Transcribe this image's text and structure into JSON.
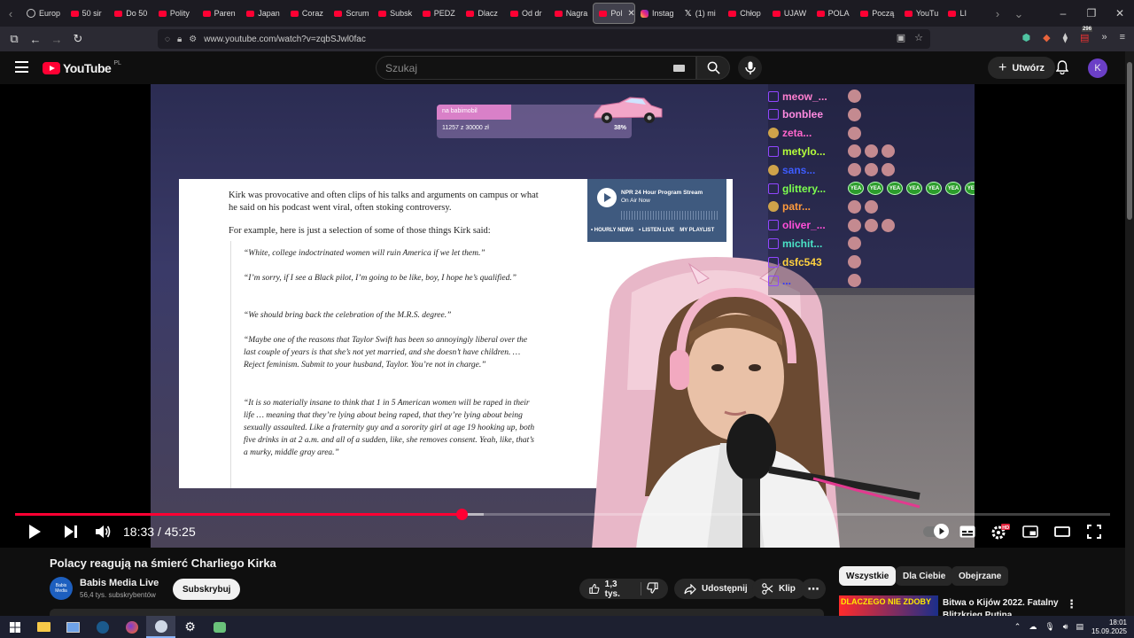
{
  "browser": {
    "tabs": [
      {
        "label": "Europ",
        "icon": "globe"
      },
      {
        "label": "50 sir",
        "icon": "youtube"
      },
      {
        "label": "Do 50",
        "icon": "youtube"
      },
      {
        "label": "Polity",
        "icon": "youtube"
      },
      {
        "label": "Paren",
        "icon": "youtube"
      },
      {
        "label": "Japan",
        "icon": "youtube"
      },
      {
        "label": "Coraz",
        "icon": "youtube"
      },
      {
        "label": "Scrum",
        "icon": "youtube"
      },
      {
        "label": "Subsk",
        "icon": "youtube"
      },
      {
        "label": "PEDZ",
        "icon": "youtube"
      },
      {
        "label": "Dlacz",
        "icon": "youtube"
      },
      {
        "label": "Od dr",
        "icon": "youtube"
      },
      {
        "label": "Nagra",
        "icon": "youtube"
      },
      {
        "label": "Pol",
        "icon": "youtube",
        "active": true
      },
      {
        "label": "Instag",
        "icon": "instagram"
      },
      {
        "label": "(1) mi",
        "icon": "x"
      },
      {
        "label": "Chłop",
        "icon": "youtube"
      },
      {
        "label": "UJAW",
        "icon": "youtube"
      },
      {
        "label": "POLA",
        "icon": "youtube"
      },
      {
        "label": "Począ",
        "icon": "youtube"
      },
      {
        "label": "YouTu",
        "icon": "youtube"
      },
      {
        "label": "LI",
        "icon": "youtube"
      }
    ],
    "url": "www.youtube.com/watch?v=zqbSJwl0fac",
    "extension_badge": "296"
  },
  "youtube": {
    "logo_text": "YouTube",
    "country_code": "PL",
    "search_placeholder": "Szukaj",
    "create_label": "Utwórz",
    "avatar_letter": "K"
  },
  "stream": {
    "donation_goal_name": "na babimobil",
    "donation_amount": "11257 z 30000 zł",
    "donation_percent": "38%",
    "donation_fraction": 0.38,
    "article_p1": "Kirk was provocative and often clips of his talks and arguments on campus or what he said on his podcast went viral, often stoking controversy.",
    "article_p2": "For example, here is just a selection of some of those things Kirk said:",
    "quotes": [
      "“White, college indoctrinated women will ruin America if we let them.”",
      "“I’m sorry, if I see a Black pilot, I’m going to be like, boy, I hope he’s qualified.”",
      "“We should bring back the celebration of the M.R.S. degree.”",
      "“Maybe one of the reasons that Taylor Swift has been so annoyingly liberal over the last couple of years is that she’s not yet married, and she doesn’t have children. … Reject feminism. Submit to your husband, Taylor. You’re not in charge.”",
      "“It is so materially insane to think that 1 in 5 American women will be raped in their life … meaning that they’re lying about being raped, that they’re lying about being sexually assaulted. Like a fraternity guy and a sorority girl at age 19 hooking up, both five drinks in at 2 a.m. and all of a sudden, like, she removes consent. Yeah, like, that’s a murky, middle gray area.”"
    ],
    "npr_title": "NPR 24 Hour Program Stream",
    "npr_sub": "On Air Now",
    "npr_links": [
      "• HOURLY NEWS",
      "• LISTEN LIVE",
      "MY PLAYLIST"
    ],
    "chat": [
      {
        "user": "meow_...",
        "color": "#ff7fd0",
        "emotes": 1,
        "yea": 0,
        "badge": "twitch"
      },
      {
        "user": "bonblee",
        "color": "#ff8ae0",
        "emotes": 1,
        "yea": 0,
        "badge": "twitch"
      },
      {
        "user": "zeta...",
        "color": "#ff66cc",
        "emotes": 1,
        "yea": 0,
        "badge": "other"
      },
      {
        "user": "metylo...",
        "color": "#b6ff3b",
        "emotes": 3,
        "yea": 0,
        "badge": "twitch"
      },
      {
        "user": "sans...",
        "color": "#3d5cff",
        "emotes": 3,
        "yea": 0,
        "badge": "other"
      },
      {
        "user": "glittery...",
        "color": "#7dff4f",
        "emotes": 0,
        "yea": 7,
        "badge": "twitch"
      },
      {
        "user": "patr...",
        "color": "#ff9a3c",
        "emotes": 2,
        "yea": 0,
        "badge": "other"
      },
      {
        "user": "oliver_...",
        "color": "#ff4fd8",
        "emotes": 3,
        "yea": 0,
        "badge": "twitch"
      },
      {
        "user": "michit...",
        "color": "#4ae3c6",
        "emotes": 1,
        "yea": 0,
        "badge": "twitch"
      },
      {
        "user": "dsfc543",
        "color": "#ffd23f",
        "emotes": 1,
        "yea": 0,
        "badge": "twitch"
      },
      {
        "user": "...",
        "color": "#2a36ff",
        "emotes": 1,
        "yea": 0,
        "badge": "twitch"
      }
    ],
    "yea_label": "YEA"
  },
  "player": {
    "current_time": "18:33",
    "separator": " / ",
    "duration": "45:25",
    "played_fraction": 0.408,
    "buffered_fraction": 0.428
  },
  "video": {
    "title": "Polacy reagują na śmierć Charliego Kirka",
    "channel_name": "Babis Media Live",
    "channel_avatar_text": "Babis Media",
    "subscribers": "56,4 tys. subskrybentów",
    "subscribe_label": "Subskrybuj",
    "likes": "1,3 tys.",
    "share_label": "Udostępnij",
    "clip_label": "Klip"
  },
  "sidebar": {
    "chips": [
      {
        "label": "Wszystkie",
        "active": true
      },
      {
        "label": "Dla Ciebie",
        "active": false
      },
      {
        "label": "Obejrzane",
        "active": false
      }
    ],
    "rec_thumb_text": "DLACZEGO NIE ZDOBY",
    "rec_title": "Bitwa o Kijów 2022. Fatalny Blitzkrieg Putina"
  },
  "taskbar": {
    "time": "18:01",
    "date": "15.09.2025"
  },
  "colors": {
    "accent_red": "#ff0033",
    "yt_bg": "#0f0f0f",
    "chip_bg": "#272727"
  }
}
